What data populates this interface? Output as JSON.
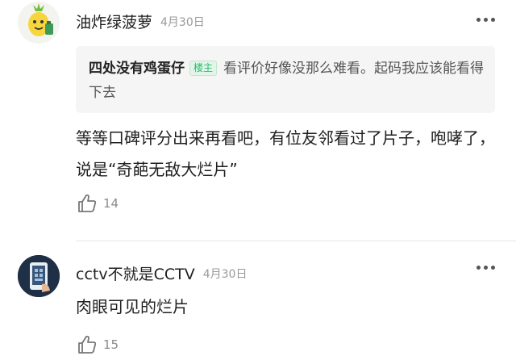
{
  "comments": [
    {
      "user": "油炸绿菠萝",
      "date": "4月30日",
      "avatar_icon": "pineapple-avatar",
      "quote": {
        "user": "四处没有鸡蛋仔",
        "badge": "楼主",
        "text": "看评价好像没那么难看。起码我应该能看得下去"
      },
      "text": "等等口碑评分出来再看吧，有位友邻看过了片子，咆哮了，说是“奇葩无敌大烂片”",
      "likes": "14"
    },
    {
      "user": "cctv不就是CCTV",
      "date": "4月30日",
      "avatar_icon": "phone-avatar",
      "text": "肉眼可见的烂片",
      "likes": "15"
    }
  ],
  "icons": {
    "like": "thumbs-up-icon",
    "more": "more-dots-icon"
  },
  "colors": {
    "badge_green": "#2eb872",
    "date_gray": "#9a9a9a",
    "quote_bg": "#f5f5f5"
  }
}
